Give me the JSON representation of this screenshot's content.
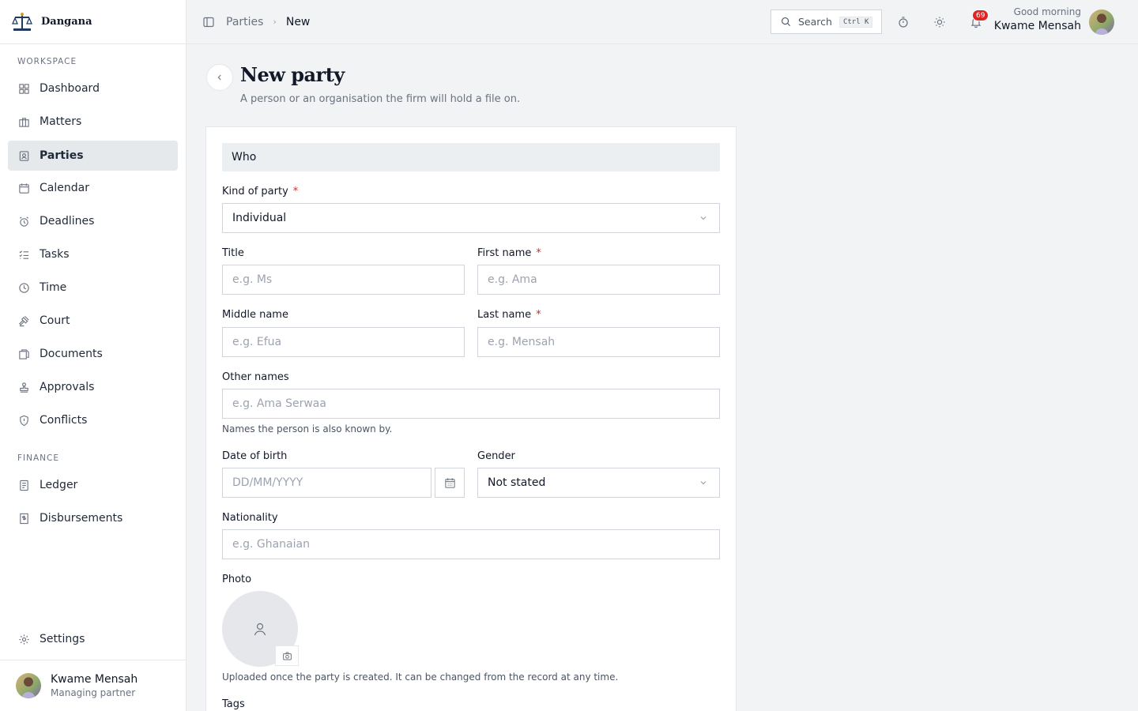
{
  "app": {
    "name": "Dangana",
    "logo_icon": "scales-of-justice-icon"
  },
  "sidebar": {
    "workspace_label": "WORKSPACE",
    "finance_label": "FINANCE",
    "items": [
      {
        "label": "Dashboard",
        "icon": "dashboard-grid-icon"
      },
      {
        "label": "Matters",
        "icon": "briefcase-icon"
      },
      {
        "label": "Parties",
        "icon": "contact-card-icon",
        "active": true
      },
      {
        "label": "Calendar",
        "icon": "calendar-icon"
      },
      {
        "label": "Deadlines",
        "icon": "alarm-clock-icon"
      },
      {
        "label": "Tasks",
        "icon": "task-list-icon"
      },
      {
        "label": "Time",
        "icon": "clock-icon"
      },
      {
        "label": "Court",
        "icon": "gavel-icon"
      },
      {
        "label": "Documents",
        "icon": "documents-icon"
      },
      {
        "label": "Approvals",
        "icon": "stamp-icon"
      },
      {
        "label": "Conflicts",
        "icon": "shield-icon"
      }
    ],
    "finance_items": [
      {
        "label": "Ledger",
        "icon": "ledger-icon"
      },
      {
        "label": "Disbursements",
        "icon": "receipt-icon"
      }
    ],
    "settings_label": "Settings",
    "user": {
      "name": "Kwame Mensah",
      "role": "Managing partner"
    }
  },
  "topbar": {
    "breadcrumb_parent": "Parties",
    "breadcrumb_current": "New",
    "search_label": "Search",
    "search_shortcut": "Ctrl K",
    "notification_count": "69",
    "greeting": "Good morning",
    "user_name": "Kwame Mensah"
  },
  "page": {
    "title": "New party",
    "subtitle": "A person or an organisation the firm will hold a file on."
  },
  "form": {
    "section_title": "Who",
    "kind_label": "Kind of party",
    "kind_value": "Individual",
    "title_label": "Title",
    "title_placeholder": "e.g. Ms",
    "first_name_label": "First name",
    "first_name_placeholder": "e.g. Ama",
    "middle_name_label": "Middle name",
    "middle_name_placeholder": "e.g. Efua",
    "last_name_label": "Last name",
    "last_name_placeholder": "e.g. Mensah",
    "other_names_label": "Other names",
    "other_names_placeholder": "e.g. Ama Serwaa",
    "other_names_help": "Names the person is also known by.",
    "dob_label": "Date of birth",
    "dob_placeholder": "DD/MM/YYYY",
    "gender_label": "Gender",
    "gender_value": "Not stated",
    "nationality_label": "Nationality",
    "nationality_placeholder": "e.g. Ghanaian",
    "photo_label": "Photo",
    "photo_help": "Uploaded once the party is created. It can be changed from the record at any time.",
    "tags_label": "Tags",
    "required_mark": "*"
  }
}
